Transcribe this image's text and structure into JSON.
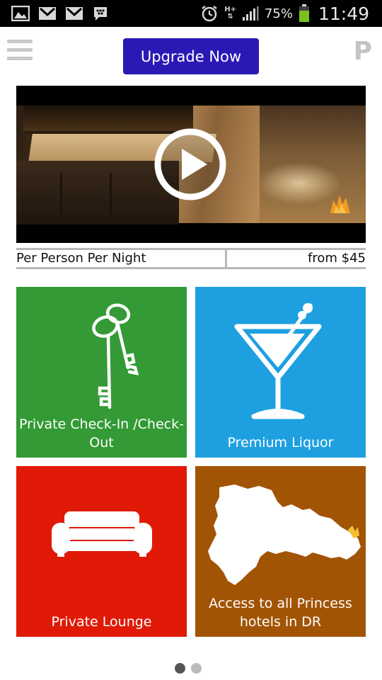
{
  "status_bar": {
    "battery_percent": "75%",
    "time": "11:49",
    "network_type_top": "H+",
    "icons": [
      "gallery-icon",
      "gmail-icon",
      "gmail-icon",
      "bbm-icon",
      "alarm-icon",
      "signal-icon",
      "battery-icon"
    ]
  },
  "header": {
    "upgrade_label": "Upgrade Now",
    "logo_letter": "P",
    "accent_color": "#2a19b5"
  },
  "video": {
    "play_icon": "play-icon"
  },
  "pricing": {
    "label": "Per Person Per Night",
    "value": "from $45"
  },
  "tiles": [
    {
      "label": "Private Check-In /Check-Out",
      "color": "#339a35",
      "icon": "keys-icon"
    },
    {
      "label": "Premium Liquor",
      "color": "#1ea0e0",
      "icon": "martini-icon"
    },
    {
      "label": "Private Lounge",
      "color": "#e01a06",
      "icon": "sofa-icon"
    },
    {
      "label": "Access to all Princess hotels in DR",
      "color": "#a25405",
      "icon": "map-icon"
    }
  ],
  "pager": {
    "active_page": 1,
    "total_pages": 2,
    "active_color": "#555555",
    "inactive_color": "#bbbbbb"
  }
}
